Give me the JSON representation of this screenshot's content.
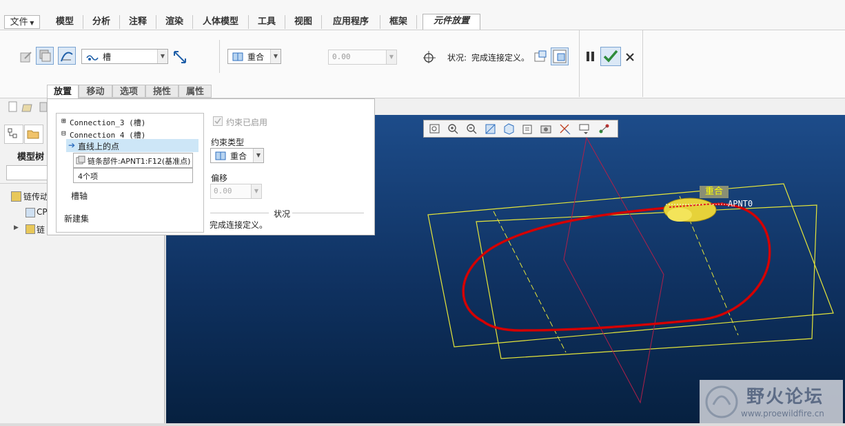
{
  "app": {
    "window_icon": "app-window-icon"
  },
  "menu": {
    "file_label": "文件"
  },
  "tabs": [
    {
      "label": "模型"
    },
    {
      "label": "分析"
    },
    {
      "label": "注释"
    },
    {
      "label": "渲染"
    },
    {
      "label": "人体模型"
    },
    {
      "label": "工具"
    },
    {
      "label": "视图"
    },
    {
      "label": "应用程序"
    },
    {
      "label": "框架"
    },
    {
      "label": "元件放置"
    }
  ],
  "ribbon": {
    "connection_type": "槽",
    "constraint_combo": "重合",
    "offset_value": "0.00",
    "status_label": "状况:",
    "status_text": "完成连接定义。"
  },
  "subtabs": [
    {
      "label": "放置"
    },
    {
      "label": "移动"
    },
    {
      "label": "选项"
    },
    {
      "label": "挠性"
    },
    {
      "label": "属性"
    }
  ],
  "popup": {
    "connection3": "Connection_3 (槽)",
    "connection4": "Connection_4 (槽)",
    "point_on_line": "直线上的点",
    "ref1": "链条部件:APNT1:F12(基准点)",
    "ref2": "4个项",
    "slot_axis": "槽轴",
    "new_set": "新建集",
    "constraint_enabled": "约束已启用",
    "constraint_type_label": "约束类型",
    "constraint_type_value": "重合",
    "offset_label": "偏移",
    "offset_value": "0.00",
    "status_heading": "状况",
    "status_text": "完成连接定义。"
  },
  "left": {
    "model_tree_label": "模型树",
    "item1": "链传动",
    "item2": "CP",
    "item3": "链"
  },
  "viewport": {
    "tag_label": "重合",
    "point_label": "APNT0"
  },
  "watermark": {
    "title": "野火论坛",
    "url": "www.proewildfire.cn"
  },
  "colors": {
    "accent": "#2f6fbf",
    "curve": "#d40000",
    "plane": "#e6e63a",
    "check": "#2e8b3a"
  }
}
